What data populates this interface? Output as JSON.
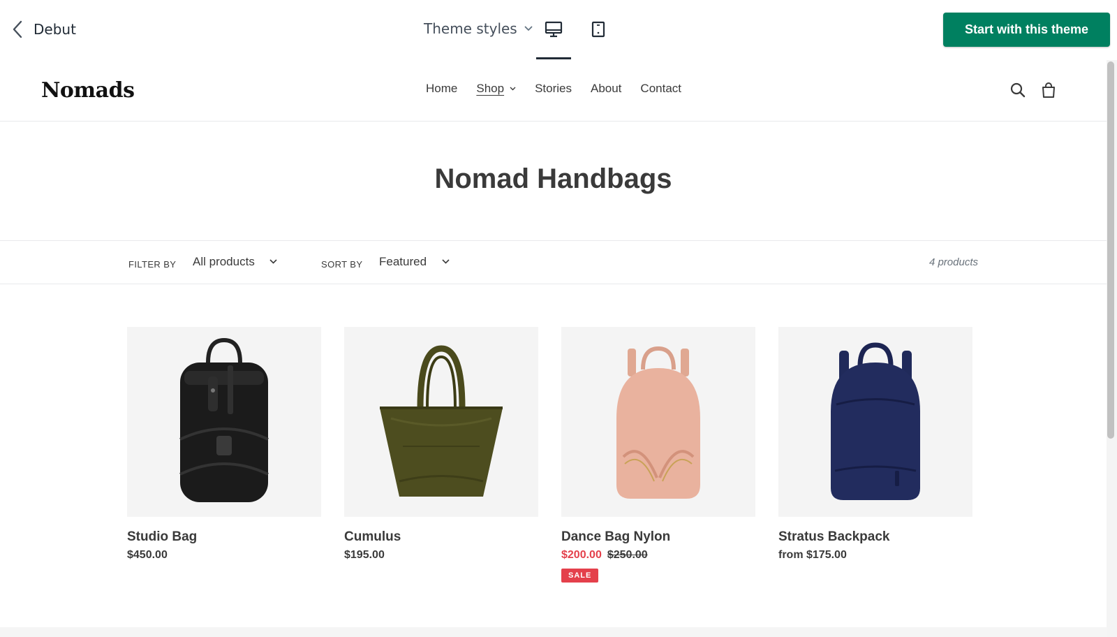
{
  "topbar": {
    "back_label": "Debut",
    "theme_styles_label": "Theme styles",
    "cta_label": "Start with this theme",
    "cta_color": "#008060"
  },
  "store": {
    "logo": "Nomads",
    "nav": [
      {
        "label": "Home"
      },
      {
        "label": "Shop"
      },
      {
        "label": "Stories"
      },
      {
        "label": "About"
      },
      {
        "label": "Contact"
      }
    ],
    "collection_title": "Nomad Handbags",
    "filter": {
      "filter_label": "FILTER BY",
      "filter_value": "All products",
      "sort_label": "SORT BY",
      "sort_value": "Featured",
      "count": "4 products"
    },
    "products": [
      {
        "title": "Studio Bag",
        "price": "$450.00",
        "image": "black-duffel-backpack",
        "color": "#1a1a1a"
      },
      {
        "title": "Cumulus",
        "price": "$195.00",
        "image": "olive-tote-bag",
        "color": "#4a4a1f"
      },
      {
        "title": "Dance Bag Nylon",
        "price": "$200.00",
        "compare_price": "$250.00",
        "badge": "SALE",
        "image": "pink-backpack",
        "color": "#e9b29d"
      },
      {
        "title": "Stratus Backpack",
        "price": "from $175.00",
        "image": "navy-backpack",
        "color": "#1f2855"
      }
    ],
    "sale_color": "#e4404b"
  }
}
